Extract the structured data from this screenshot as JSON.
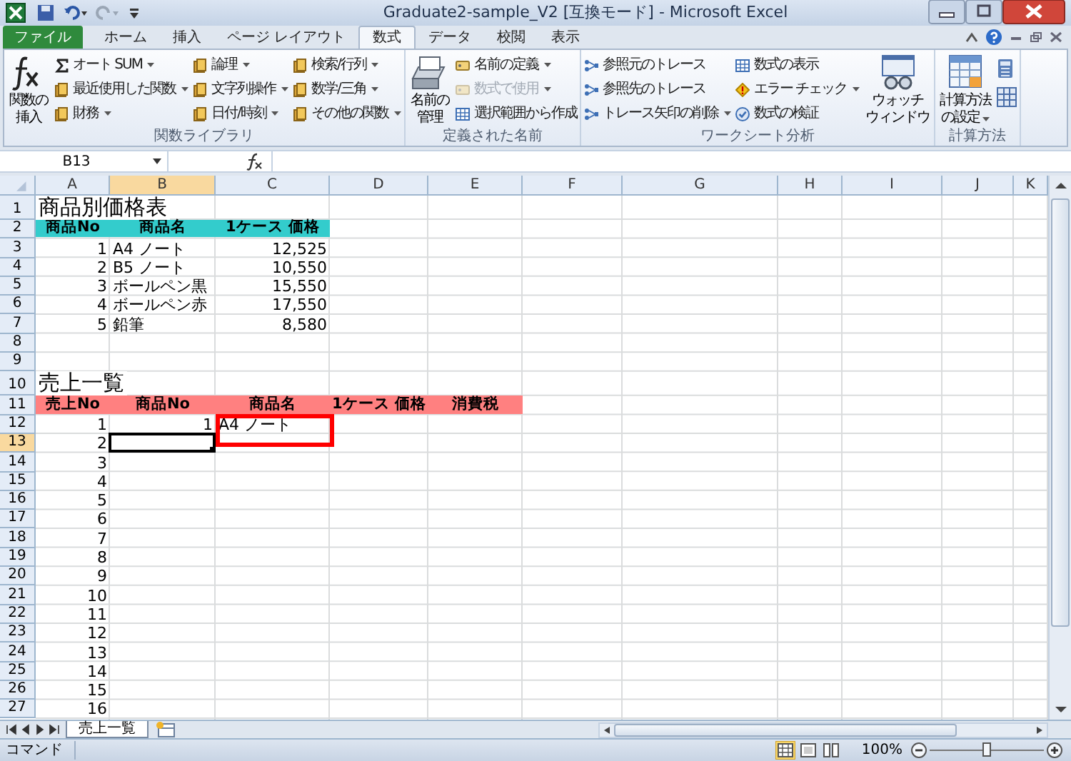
{
  "window": {
    "title": "Graduate2-sample_V2  [互換モード] - Microsoft Excel"
  },
  "tabs": [
    {
      "label": "ファイル",
      "kind": "file",
      "selected": false
    },
    {
      "label": "ホーム",
      "kind": "tab",
      "selected": false
    },
    {
      "label": "挿入",
      "kind": "tab",
      "selected": false
    },
    {
      "label": "ページ レイアウト",
      "kind": "tab",
      "selected": false
    },
    {
      "label": "数式",
      "kind": "tab",
      "selected": true
    },
    {
      "label": "データ",
      "kind": "tab",
      "selected": false
    },
    {
      "label": "校閲",
      "kind": "tab",
      "selected": false
    },
    {
      "label": "表示",
      "kind": "tab",
      "selected": false
    }
  ],
  "ribbon": {
    "groups": [
      {
        "label": "関数ライブラリ",
        "controls": [
          {
            "kind": "large",
            "lines": [
              "関数の",
              "挿入"
            ],
            "dropdown": false
          },
          {
            "kind": "stack",
            "items": [
              {
                "label": "オート SUM",
                "dropdown": true,
                "disabled": false
              },
              {
                "label": "最近使用した関数",
                "dropdown": true,
                "disabled": false
              },
              {
                "label": "財務",
                "dropdown": true,
                "disabled": false
              }
            ]
          },
          {
            "kind": "stack",
            "items": [
              {
                "label": "論理",
                "dropdown": true,
                "disabled": false
              },
              {
                "label": "文字列操作",
                "dropdown": true,
                "disabled": false
              },
              {
                "label": "日付/時刻",
                "dropdown": true,
                "disabled": false
              }
            ]
          },
          {
            "kind": "stack",
            "items": [
              {
                "label": "検索/行列",
                "dropdown": true,
                "disabled": false
              },
              {
                "label": "数学/三角",
                "dropdown": true,
                "disabled": false
              },
              {
                "label": "その他の関数",
                "dropdown": true,
                "disabled": false
              }
            ]
          }
        ]
      },
      {
        "label": "定義された名前",
        "controls": [
          {
            "kind": "large",
            "lines": [
              "名前の",
              "管理"
            ],
            "dropdown": false
          },
          {
            "kind": "stack",
            "items": [
              {
                "label": "名前の定義",
                "dropdown": true,
                "disabled": false
              },
              {
                "label": "数式で使用",
                "dropdown": true,
                "disabled": true
              },
              {
                "label": "選択範囲から作成",
                "dropdown": false,
                "disabled": false
              }
            ]
          }
        ]
      },
      {
        "label": "ワークシート分析",
        "controls": [
          {
            "kind": "stack",
            "items": [
              {
                "label": "参照元のトレース",
                "dropdown": false,
                "disabled": false
              },
              {
                "label": "参照先のトレース",
                "dropdown": false,
                "disabled": false
              },
              {
                "label": "トレース矢印の削除",
                "dropdown": true,
                "disabled": false
              }
            ]
          },
          {
            "kind": "stack",
            "items": [
              {
                "label": "数式の表示",
                "dropdown": false,
                "disabled": false
              },
              {
                "label": "エラー チェック",
                "dropdown": true,
                "disabled": false
              },
              {
                "label": "数式の検証",
                "dropdown": false,
                "disabled": false
              }
            ]
          },
          {
            "kind": "large",
            "lines": [
              "ウォッチ",
              "ウィンドウ"
            ],
            "dropdown": false
          }
        ]
      },
      {
        "label": "計算方法",
        "controls": [
          {
            "kind": "large",
            "lines": [
              "計算方法",
              "の設定"
            ],
            "dropdown": true
          },
          {
            "kind": "icon_stack"
          }
        ]
      }
    ]
  },
  "formula_bar": {
    "name_box": "B13"
  },
  "sheet": {
    "columns": [
      {
        "label": "A",
        "selected": false
      },
      {
        "label": "B",
        "selected": true
      },
      {
        "label": "C",
        "selected": false
      },
      {
        "label": "D",
        "selected": false
      },
      {
        "label": "E",
        "selected": false
      },
      {
        "label": "F",
        "selected": false
      },
      {
        "label": "G",
        "selected": false
      },
      {
        "label": "H",
        "selected": false
      },
      {
        "label": "I",
        "selected": false
      },
      {
        "label": "J",
        "selected": false
      },
      {
        "label": "K",
        "selected": false
      }
    ],
    "rows": [
      {
        "header": "1",
        "selected": false,
        "cells": [
          {
            "text": "商品別価格表",
            "kind": "heading",
            "marked": false
          }
        ]
      },
      {
        "header": "2",
        "selected": false,
        "cells": [
          {
            "text": "商品No",
            "kind": "header",
            "color": "#33cccc",
            "marked": false
          },
          {
            "text": "商品名",
            "kind": "header",
            "color": "#33cccc",
            "marked": false
          },
          {
            "text": "1ケース 価格",
            "kind": "header",
            "color": "#33cccc",
            "marked": false
          }
        ]
      },
      {
        "header": "3",
        "selected": false,
        "cells": [
          {
            "text": "1",
            "kind": "number",
            "marked": false
          },
          {
            "text": "A4 ノート",
            "kind": "text",
            "marked": false
          },
          {
            "text": "12,525",
            "kind": "number",
            "marked": false
          }
        ]
      },
      {
        "header": "4",
        "selected": false,
        "cells": [
          {
            "text": "2",
            "kind": "number",
            "marked": false
          },
          {
            "text": "B5 ノート",
            "kind": "text",
            "marked": false
          },
          {
            "text": "10,550",
            "kind": "number",
            "marked": false
          }
        ]
      },
      {
        "header": "5",
        "selected": false,
        "cells": [
          {
            "text": "3",
            "kind": "number",
            "marked": false
          },
          {
            "text": "ボールペン黒",
            "kind": "text",
            "marked": false
          },
          {
            "text": "15,550",
            "kind": "number",
            "marked": false
          }
        ]
      },
      {
        "header": "6",
        "selected": false,
        "cells": [
          {
            "text": "4",
            "kind": "number",
            "marked": false
          },
          {
            "text": "ボールペン赤",
            "kind": "text",
            "marked": false
          },
          {
            "text": "17,550",
            "kind": "number",
            "marked": false
          }
        ]
      },
      {
        "header": "7",
        "selected": false,
        "cells": [
          {
            "text": "5",
            "kind": "number",
            "marked": false
          },
          {
            "text": "鉛筆",
            "kind": "text",
            "marked": false
          },
          {
            "text": "8,580",
            "kind": "number",
            "marked": false
          }
        ]
      },
      {
        "header": "8",
        "selected": false,
        "cells": []
      },
      {
        "header": "9",
        "selected": false,
        "cells": []
      },
      {
        "header": "10",
        "selected": false,
        "cells": [
          {
            "text": "売上一覧",
            "kind": "heading",
            "marked": false
          }
        ]
      },
      {
        "header": "11",
        "selected": false,
        "cells": [
          {
            "text": "売上No",
            "kind": "header",
            "color": "#ff8080",
            "marked": false
          },
          {
            "text": "商品No",
            "kind": "header",
            "color": "#ff8080",
            "marked": false
          },
          {
            "text": "商品名",
            "kind": "header",
            "color": "#ff8080",
            "marked": false
          },
          {
            "text": "1ケース 価格",
            "kind": "header",
            "color": "#ff8080",
            "marked": false
          },
          {
            "text": "消費税",
            "kind": "header",
            "color": "#ff8080",
            "marked": false
          }
        ]
      },
      {
        "header": "12",
        "selected": false,
        "cells": [
          {
            "text": "1",
            "kind": "number",
            "marked": false
          },
          {
            "text": "1",
            "kind": "number",
            "marked": false
          },
          {
            "text": "A4 ノート",
            "kind": "text",
            "marked": true
          }
        ]
      },
      {
        "header": "13",
        "selected": true,
        "cells": [
          {
            "text": "2",
            "kind": "number",
            "marked": false
          }
        ]
      },
      {
        "header": "14",
        "selected": false,
        "cells": [
          {
            "text": "3",
            "kind": "number",
            "marked": false
          }
        ]
      },
      {
        "header": "15",
        "selected": false,
        "cells": [
          {
            "text": "4",
            "kind": "number",
            "marked": false
          }
        ]
      },
      {
        "header": "16",
        "selected": false,
        "cells": [
          {
            "text": "5",
            "kind": "number",
            "marked": false
          }
        ]
      },
      {
        "header": "17",
        "selected": false,
        "cells": [
          {
            "text": "6",
            "kind": "number",
            "marked": false
          }
        ]
      },
      {
        "header": "18",
        "selected": false,
        "cells": [
          {
            "text": "7",
            "kind": "number",
            "marked": false
          }
        ]
      },
      {
        "header": "19",
        "selected": false,
        "cells": [
          {
            "text": "8",
            "kind": "number",
            "marked": false
          }
        ]
      },
      {
        "header": "20",
        "selected": false,
        "cells": [
          {
            "text": "9",
            "kind": "number",
            "marked": false
          }
        ]
      },
      {
        "header": "21",
        "selected": false,
        "cells": [
          {
            "text": "10",
            "kind": "number",
            "marked": false
          }
        ]
      },
      {
        "header": "22",
        "selected": false,
        "cells": [
          {
            "text": "11",
            "kind": "number",
            "marked": false
          }
        ]
      },
      {
        "header": "23",
        "selected": false,
        "cells": [
          {
            "text": "12",
            "kind": "number",
            "marked": false
          }
        ]
      },
      {
        "header": "24",
        "selected": false,
        "cells": [
          {
            "text": "13",
            "kind": "number",
            "marked": false
          }
        ]
      },
      {
        "header": "25",
        "selected": false,
        "cells": [
          {
            "text": "14",
            "kind": "number",
            "marked": false
          }
        ]
      },
      {
        "header": "26",
        "selected": false,
        "cells": [
          {
            "text": "15",
            "kind": "number",
            "marked": false
          }
        ]
      },
      {
        "header": "27",
        "selected": false,
        "cells": [
          {
            "text": "16",
            "kind": "number",
            "marked": false
          }
        ]
      }
    ]
  },
  "sheet_tabs": [
    {
      "label": "売上一覧",
      "selected": true
    }
  ],
  "status_bar": {
    "mode": "コマンド",
    "views": [
      {
        "kind": "normal",
        "selected": true
      },
      {
        "kind": "page_layout",
        "selected": false
      },
      {
        "kind": "page_break",
        "selected": false
      }
    ],
    "zoom": "100%",
    "zoom_slider": {
      "level": 0.5
    }
  }
}
